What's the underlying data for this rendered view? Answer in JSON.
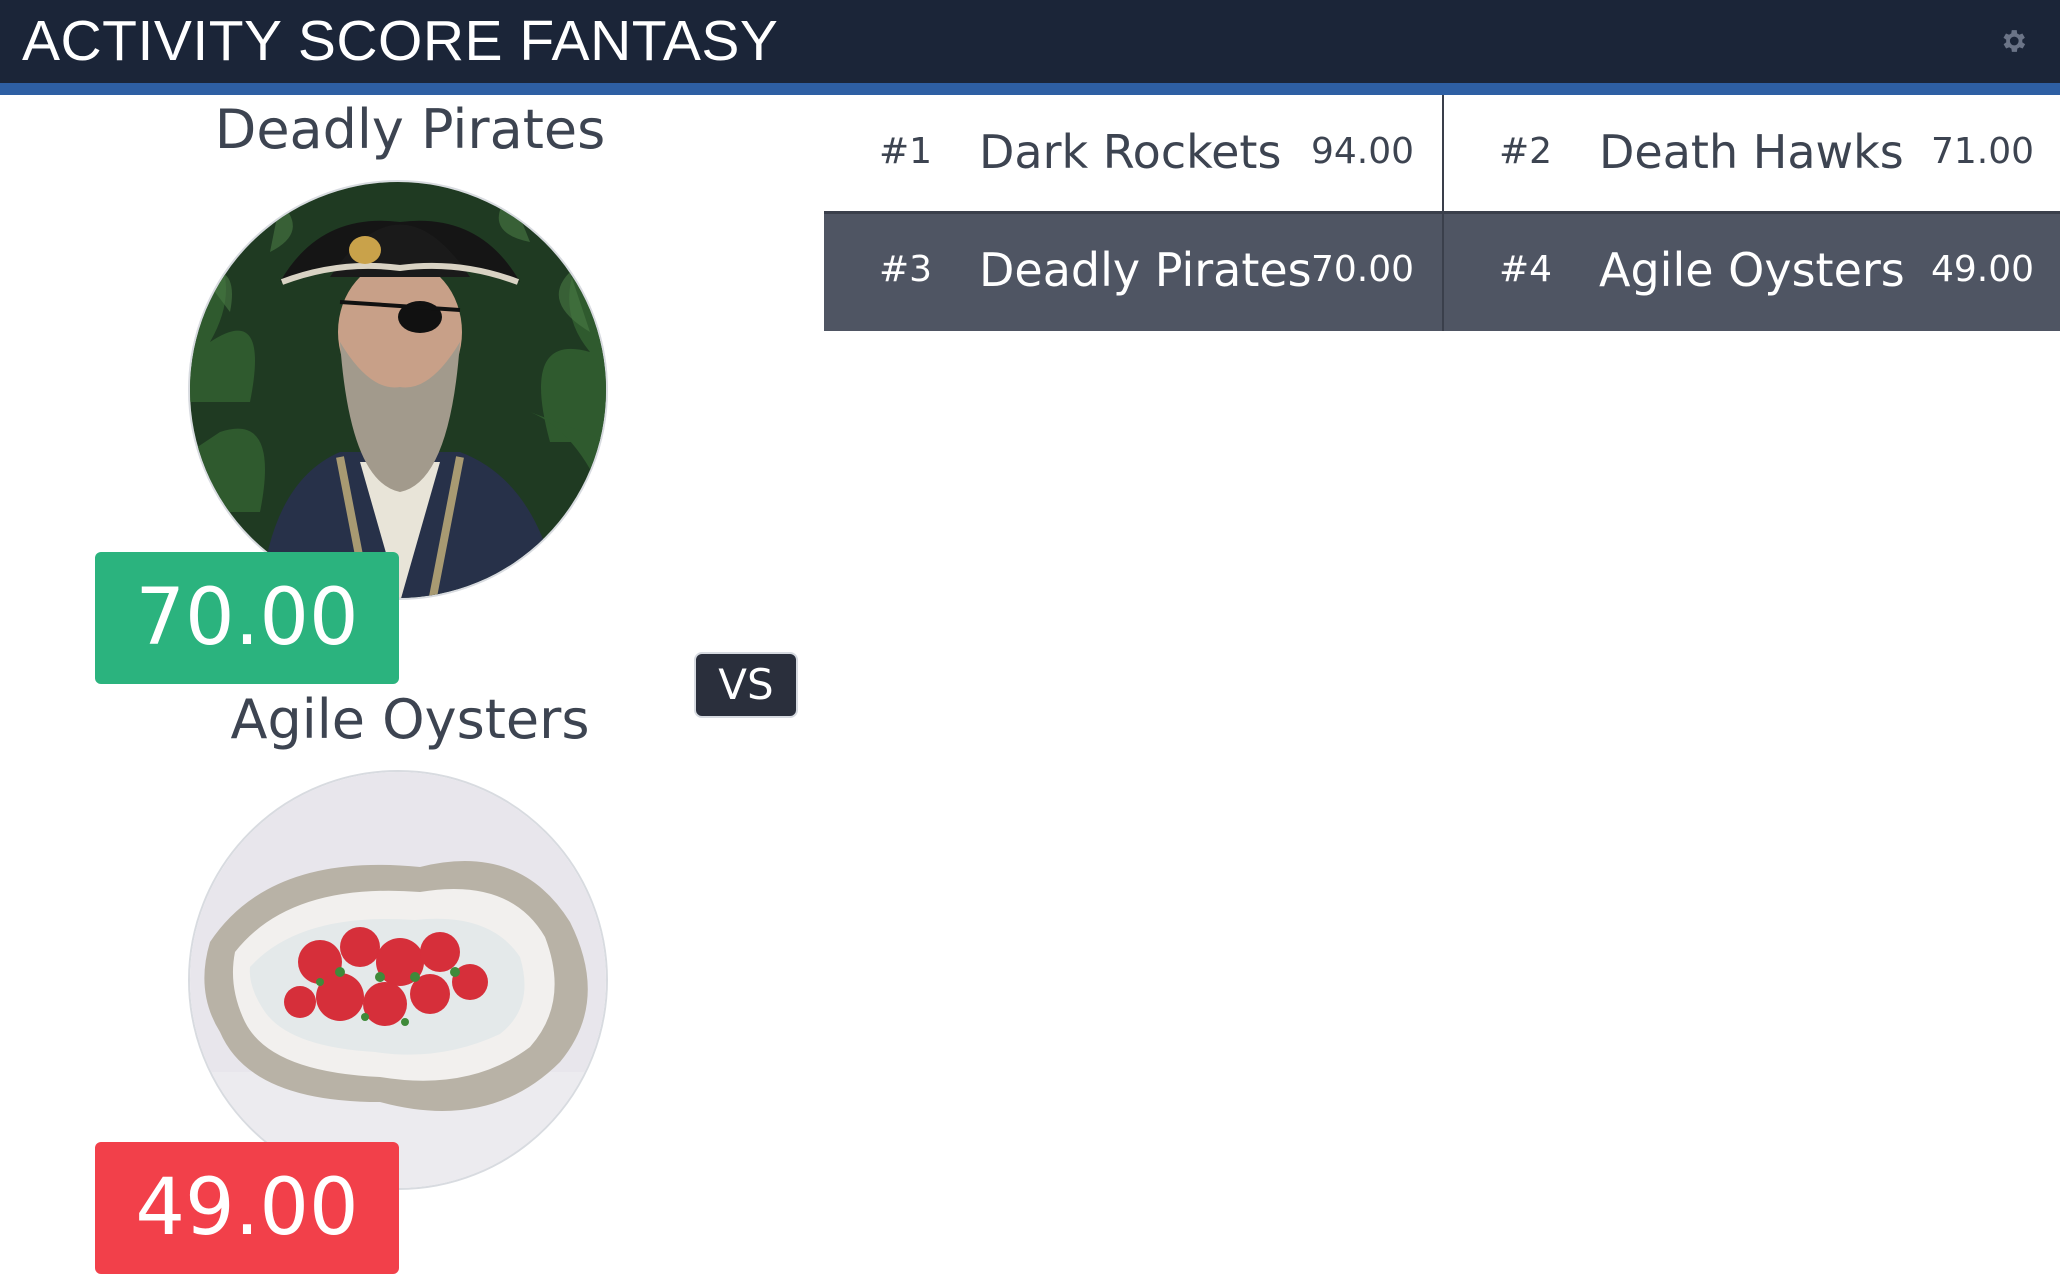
{
  "header": {
    "title": "ACTIVITY SCORE FANTASY",
    "settings_icon": "gear-icon"
  },
  "matchup": {
    "home": {
      "name": "Deadly Pirates",
      "score": "70.00",
      "status_color": "#2bb37e",
      "avatar": "pirate-photo"
    },
    "away": {
      "name": "Agile Oysters",
      "score": "49.00",
      "status_color": "#f2404a",
      "avatar": "oyster-photo"
    },
    "vs_label": "VS"
  },
  "standings": [
    {
      "rank": "#1",
      "name": "Dark Rockets",
      "score": "94.00"
    },
    {
      "rank": "#2",
      "name": "Death Hawks",
      "score": "71.00"
    },
    {
      "rank": "#3",
      "name": "Deadly Pirates",
      "score": "70.00"
    },
    {
      "rank": "#4",
      "name": "Agile Oysters",
      "score": "49.00"
    }
  ],
  "colors": {
    "header_bg": "#1b2538",
    "accent": "#2e5fa3",
    "highlight_row": "#4f5563"
  }
}
